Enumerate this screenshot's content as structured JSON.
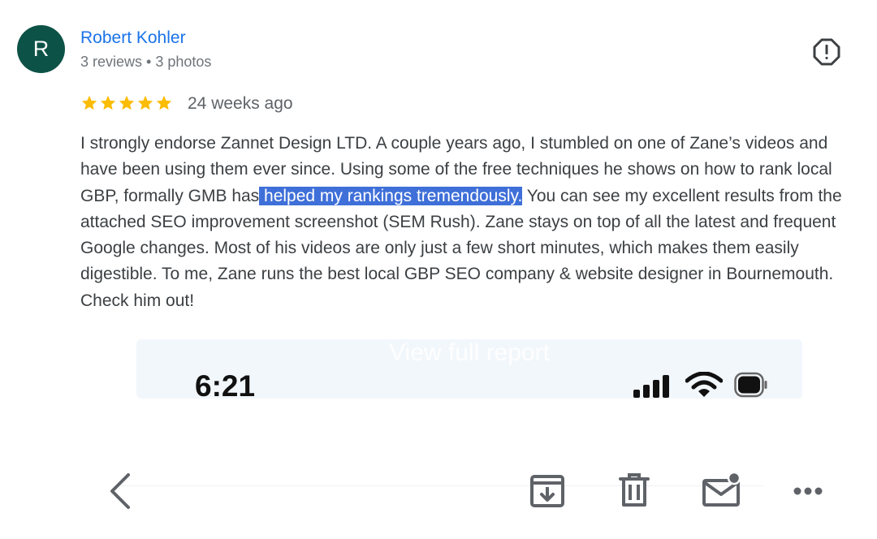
{
  "reviewer": {
    "initial": "R",
    "name": "Robert Kohler",
    "meta": "3 reviews • 3 photos",
    "avatar_color": "#0d5247"
  },
  "review": {
    "rating": 5,
    "max_rating": 5,
    "time": "24 weeks ago",
    "text_before": "I strongly endorse Zannet Design LTD. A couple years ago, I stumbled on one of Zane’s videos and have been using them ever since. Using some of the free techniques he shows on how to rank local GBP, formally GMB has",
    "text_highlight": " helped my rankings tremendously.",
    "text_after": " You can see my excellent results from the attached SEO improvement screenshot (SEM Rush). Zane stays on top of all the latest and frequent Google changes. Most of his videos are only just a few short minutes, which makes them easily digestible. To me, Zane runs the best local GBP SEO company & website designer in Bournemouth. Check him out!"
  },
  "attachment": {
    "overlay_label": "View full report",
    "phone_time": "6:21"
  },
  "toolbar": {
    "icons": [
      "back-icon",
      "archive-icon",
      "delete-icon",
      "mark-unread-icon",
      "more-icon"
    ]
  },
  "colors": {
    "name_link": "#1a73e8",
    "star": "#fbbc04",
    "highlight": "#3f6fd8",
    "icon": "#5f6368"
  }
}
